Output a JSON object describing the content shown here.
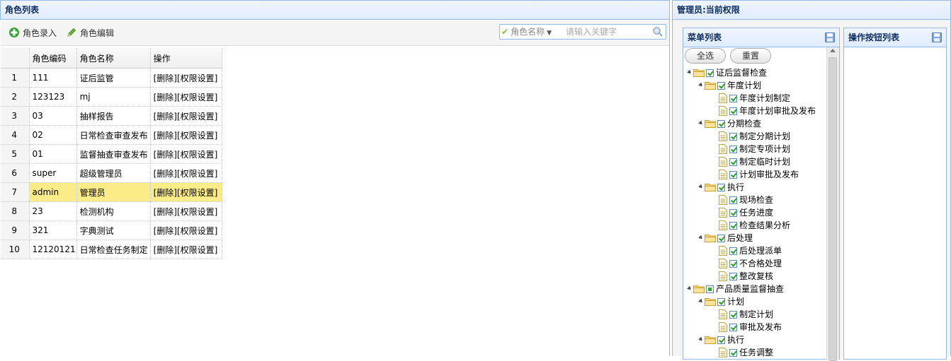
{
  "left": {
    "title": "角色列表",
    "toolbar": {
      "add_label": "角色录入",
      "edit_label": "角色编辑"
    },
    "search": {
      "field_label": "角色名称",
      "placeholder": "请输入关键字"
    },
    "columns": [
      "角色编码",
      "角色名称",
      "操作"
    ],
    "rows": [
      {
        "n": "1",
        "code": "111",
        "name": "证后监管",
        "del": "[删除]",
        "perm": "[权限设置]"
      },
      {
        "n": "2",
        "code": "123123",
        "name": "mj",
        "del": "[删除]",
        "perm": "[权限设置]"
      },
      {
        "n": "3",
        "code": "03",
        "name": "抽样报告",
        "del": "[删除]",
        "perm": "[权限设置]"
      },
      {
        "n": "4",
        "code": "02",
        "name": "日常检查审查发布",
        "del": "[删除]",
        "perm": "[权限设置]"
      },
      {
        "n": "5",
        "code": "01",
        "name": "监督抽查审查发布",
        "del": "[删除]",
        "perm": "[权限设置]"
      },
      {
        "n": "6",
        "code": "super",
        "name": "超级管理员",
        "del": "[删除]",
        "perm": "[权限设置]"
      },
      {
        "n": "7",
        "code": "admin",
        "name": "管理员",
        "del": "[删除]",
        "perm": "[权限设置]"
      },
      {
        "n": "8",
        "code": "23",
        "name": "检测机构",
        "del": "[删除]",
        "perm": "[权限设置]"
      },
      {
        "n": "9",
        "code": "321",
        "name": "字典测试",
        "del": "[删除]",
        "perm": "[权限设置]"
      },
      {
        "n": "10",
        "code": "12120121",
        "name": "日常检查任务制定",
        "del": "[删除]",
        "perm": "[权限设置]"
      }
    ],
    "selected_row": "7"
  },
  "right": {
    "title": "管理员:当前权限",
    "menu_panel_title": "菜单列表",
    "button_panel_title": "操作按钮列表",
    "select_all_label": "全选",
    "reset_label": "重置",
    "tree": [
      {
        "level": 0,
        "type": "folder",
        "check": "checked",
        "label": "证后监督检查"
      },
      {
        "level": 1,
        "type": "folder",
        "check": "checked",
        "label": "年度计划"
      },
      {
        "level": 2,
        "type": "leaf",
        "check": "checked",
        "label": "年度计划制定"
      },
      {
        "level": 2,
        "type": "leaf",
        "check": "checked",
        "label": "年度计划审批及发布"
      },
      {
        "level": 1,
        "type": "folder",
        "check": "checked",
        "label": "分期检查"
      },
      {
        "level": 2,
        "type": "leaf",
        "check": "checked",
        "label": "制定分期计划"
      },
      {
        "level": 2,
        "type": "leaf",
        "check": "checked",
        "label": "制定专项计划"
      },
      {
        "level": 2,
        "type": "leaf",
        "check": "checked",
        "label": "制定临时计划"
      },
      {
        "level": 2,
        "type": "leaf",
        "check": "checked",
        "label": "计划审批及发布"
      },
      {
        "level": 1,
        "type": "folder",
        "check": "checked",
        "label": "执行"
      },
      {
        "level": 2,
        "type": "leaf",
        "check": "checked",
        "label": "现场检查"
      },
      {
        "level": 2,
        "type": "leaf",
        "check": "checked",
        "label": "任务进度"
      },
      {
        "level": 2,
        "type": "leaf",
        "check": "checked",
        "label": "检查结果分析"
      },
      {
        "level": 1,
        "type": "folder",
        "check": "checked",
        "label": "后处理"
      },
      {
        "level": 2,
        "type": "leaf",
        "check": "checked",
        "label": "后处理派单"
      },
      {
        "level": 2,
        "type": "leaf",
        "check": "checked",
        "label": "不合格处理"
      },
      {
        "level": 2,
        "type": "leaf",
        "check": "checked",
        "label": "整改复核"
      },
      {
        "level": 0,
        "type": "folder",
        "check": "partial",
        "label": "产品质量监督抽查"
      },
      {
        "level": 1,
        "type": "folder",
        "check": "checked",
        "label": "计划"
      },
      {
        "level": 2,
        "type": "leaf",
        "check": "checked",
        "label": "制定计划"
      },
      {
        "level": 2,
        "type": "leaf",
        "check": "checked",
        "label": "审批及发布"
      },
      {
        "level": 1,
        "type": "folder",
        "check": "checked",
        "label": "执行"
      },
      {
        "level": 2,
        "type": "leaf",
        "check": "checked",
        "label": "任务调整"
      }
    ]
  },
  "colors": {
    "accent": "#95b8e7",
    "header_text": "#0e2d5f",
    "selected_row": "#fbec88",
    "check_green": "#2b9a2b"
  }
}
